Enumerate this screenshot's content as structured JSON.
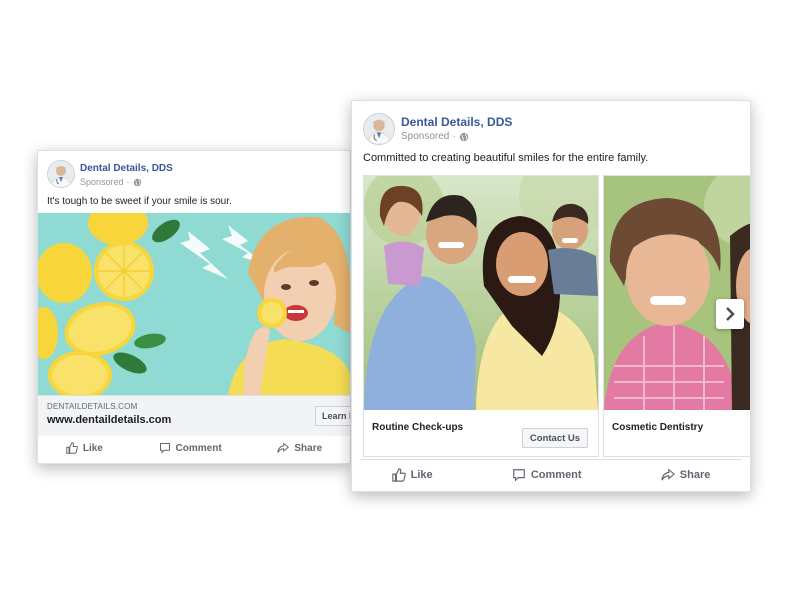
{
  "left_ad": {
    "page_name": "Dental Details, DDS",
    "sponsored": "Sponsored",
    "sponsored_sep": "·",
    "post_text": "It's tough to be sweet if your smile is sour.",
    "link_domain": "DENTAILDETAILS.COM",
    "link_url": "www.dentaildetails.com",
    "cta_label": "Learn More",
    "actions": {
      "like": "Like",
      "comment": "Comment",
      "share": "Share"
    }
  },
  "right_ad": {
    "page_name": "Dental Details, DDS",
    "sponsored": "Sponsored",
    "sponsored_sep": "·",
    "post_text": "Committed to creating beautiful smiles for the entire family.",
    "carousel": [
      {
        "title": "Routine Check-ups",
        "cta_label": "Contact Us"
      },
      {
        "title": "Cosmetic Dentistry"
      }
    ],
    "actions": {
      "like": "Like",
      "comment": "Comment",
      "share": "Share"
    }
  },
  "colors": {
    "page_name": "#385898",
    "muted": "#90949c",
    "lemon_bg": "#8fdad2",
    "lemon": "#f8d63b",
    "shirt_yellow": "#f4dc55"
  },
  "icons": [
    "doctor-avatar-icon",
    "globe-icon",
    "like-icon",
    "comment-icon",
    "share-icon",
    "chevron-right-icon"
  ]
}
